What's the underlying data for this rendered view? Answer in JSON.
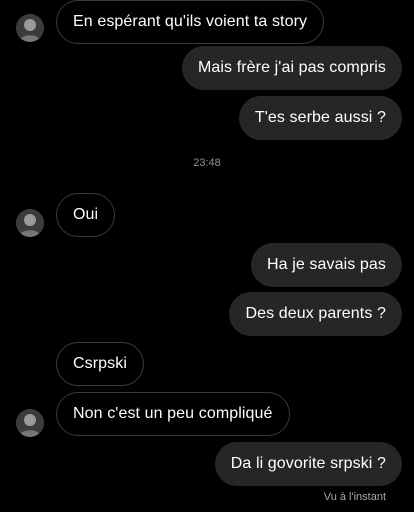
{
  "conversation": {
    "messages": [
      {
        "side": "received",
        "text": "En espérant qu'ils voient ta story",
        "avatar": true
      },
      {
        "side": "sent",
        "text": "Mais frère j'ai pas compris"
      },
      {
        "side": "sent",
        "text": "T'es serbe aussi ?"
      },
      {
        "side": "received",
        "text": "Oui",
        "avatar": true
      },
      {
        "side": "sent",
        "text": "Ha je savais pas"
      },
      {
        "side": "sent",
        "text": "Des deux parents ?"
      },
      {
        "side": "received",
        "text": "Csrpski",
        "avatar": false
      },
      {
        "side": "received",
        "text": "Non c'est un peu compliqué",
        "avatar": true
      },
      {
        "side": "sent",
        "text": "Da li govorite srpski ?"
      }
    ],
    "timestamp": "23:48",
    "seen_status": "Vu à l'instant"
  },
  "colors": {
    "background": "#000000",
    "sent_bubble": "#262626",
    "received_border": "#3a3a3c",
    "meta_text": "#8e8e8e"
  },
  "icons": {
    "avatar": "profile-photo-icon"
  }
}
